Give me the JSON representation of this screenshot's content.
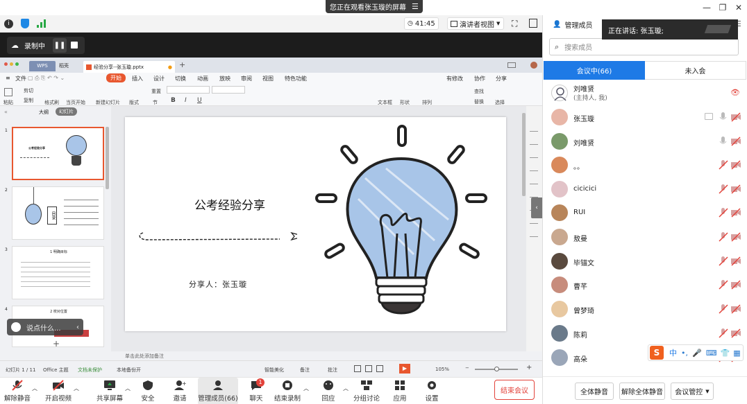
{
  "banner": {
    "text": "您正在观看张玉璇的屏幕",
    "menu_icon": "menu-icon"
  },
  "topbar": {
    "timer": "41:45",
    "view_mode": "演讲者视图"
  },
  "recording": {
    "label": "录制中"
  },
  "wps": {
    "tabs": [
      "WPS",
      "稻壳",
      "经验分享--张玉璇.pptx"
    ],
    "menu": [
      "文件",
      "开始",
      "插入",
      "设计",
      "切换",
      "动画",
      "放映",
      "审阅",
      "视图",
      "特色功能"
    ],
    "menu_right": [
      "有修改",
      "协作",
      "分享"
    ],
    "tool_groups": [
      "粘贴",
      "剪切",
      "复制",
      "格式刷",
      "当页开始",
      "新建幻灯片",
      "版式",
      "节",
      "重置",
      "文本框",
      "形状",
      "排列",
      "查找",
      "替换",
      "选择"
    ],
    "thumb_tabs": [
      "大纲",
      "幻灯片"
    ],
    "slide_numbers": [
      "1",
      "2",
      "3",
      "4"
    ],
    "thumb2_label": "目录",
    "thumb3_title": "1 明确目标",
    "thumb4_title": "2 校对位置",
    "chat_placeholder": "说点什么...",
    "notes_hint": "单击此处添加备注",
    "status_left": [
      "幻灯片 1 / 11",
      "Office 主题",
      "文档未保护",
      "本地备份开"
    ],
    "status_right": [
      "智能美化",
      "备注",
      "批注"
    ],
    "zoom": "105%"
  },
  "slide": {
    "title": "公考经验分享",
    "presenter": "分享人：张玉璇"
  },
  "toolbar": {
    "items": [
      "解除静音",
      "开启视频",
      "共享屏幕",
      "安全",
      "邀请",
      "管理成员(66)",
      "聊天",
      "结束录制",
      "回应",
      "分组讨论",
      "应用",
      "设置"
    ],
    "chat_badge": "1",
    "end": "结束会议"
  },
  "panel": {
    "title": "管理成员",
    "speaking": "正在讲话: 张玉璇;",
    "search_placeholder": "搜索成员",
    "tab_in": "会议中(66)",
    "tab_out": "未入会",
    "members": [
      {
        "name": "刘唯贤",
        "sub": "(主持人, 我)",
        "color": "#fff"
      },
      {
        "name": "张玉璇",
        "sub": "",
        "color": "#e8b6a7"
      },
      {
        "name": "刘唯贤",
        "sub": "",
        "color": "#7a9a6a"
      },
      {
        "name": "。。",
        "sub": "",
        "color": "#d9895b"
      },
      {
        "name": "cicicici",
        "sub": "",
        "color": "#e2c3c8"
      },
      {
        "name": "RUI",
        "sub": "",
        "color": "#b8855a"
      },
      {
        "name": "敖曼",
        "sub": "",
        "color": "#c9a88f"
      },
      {
        "name": "毕锚文",
        "sub": "",
        "color": "#5a4a3e"
      },
      {
        "name": "曹芊",
        "sub": "",
        "color": "#c78c7c"
      },
      {
        "name": "曾梦琦",
        "sub": "",
        "color": "#e8c8a0"
      },
      {
        "name": "陈莉",
        "sub": "",
        "color": "#6a7a8a"
      },
      {
        "name": "高朵",
        "sub": "",
        "color": "#9aa6b8"
      }
    ],
    "footer": [
      "全体静音",
      "解除全体静音",
      "会议管控"
    ],
    "ime": "中"
  }
}
